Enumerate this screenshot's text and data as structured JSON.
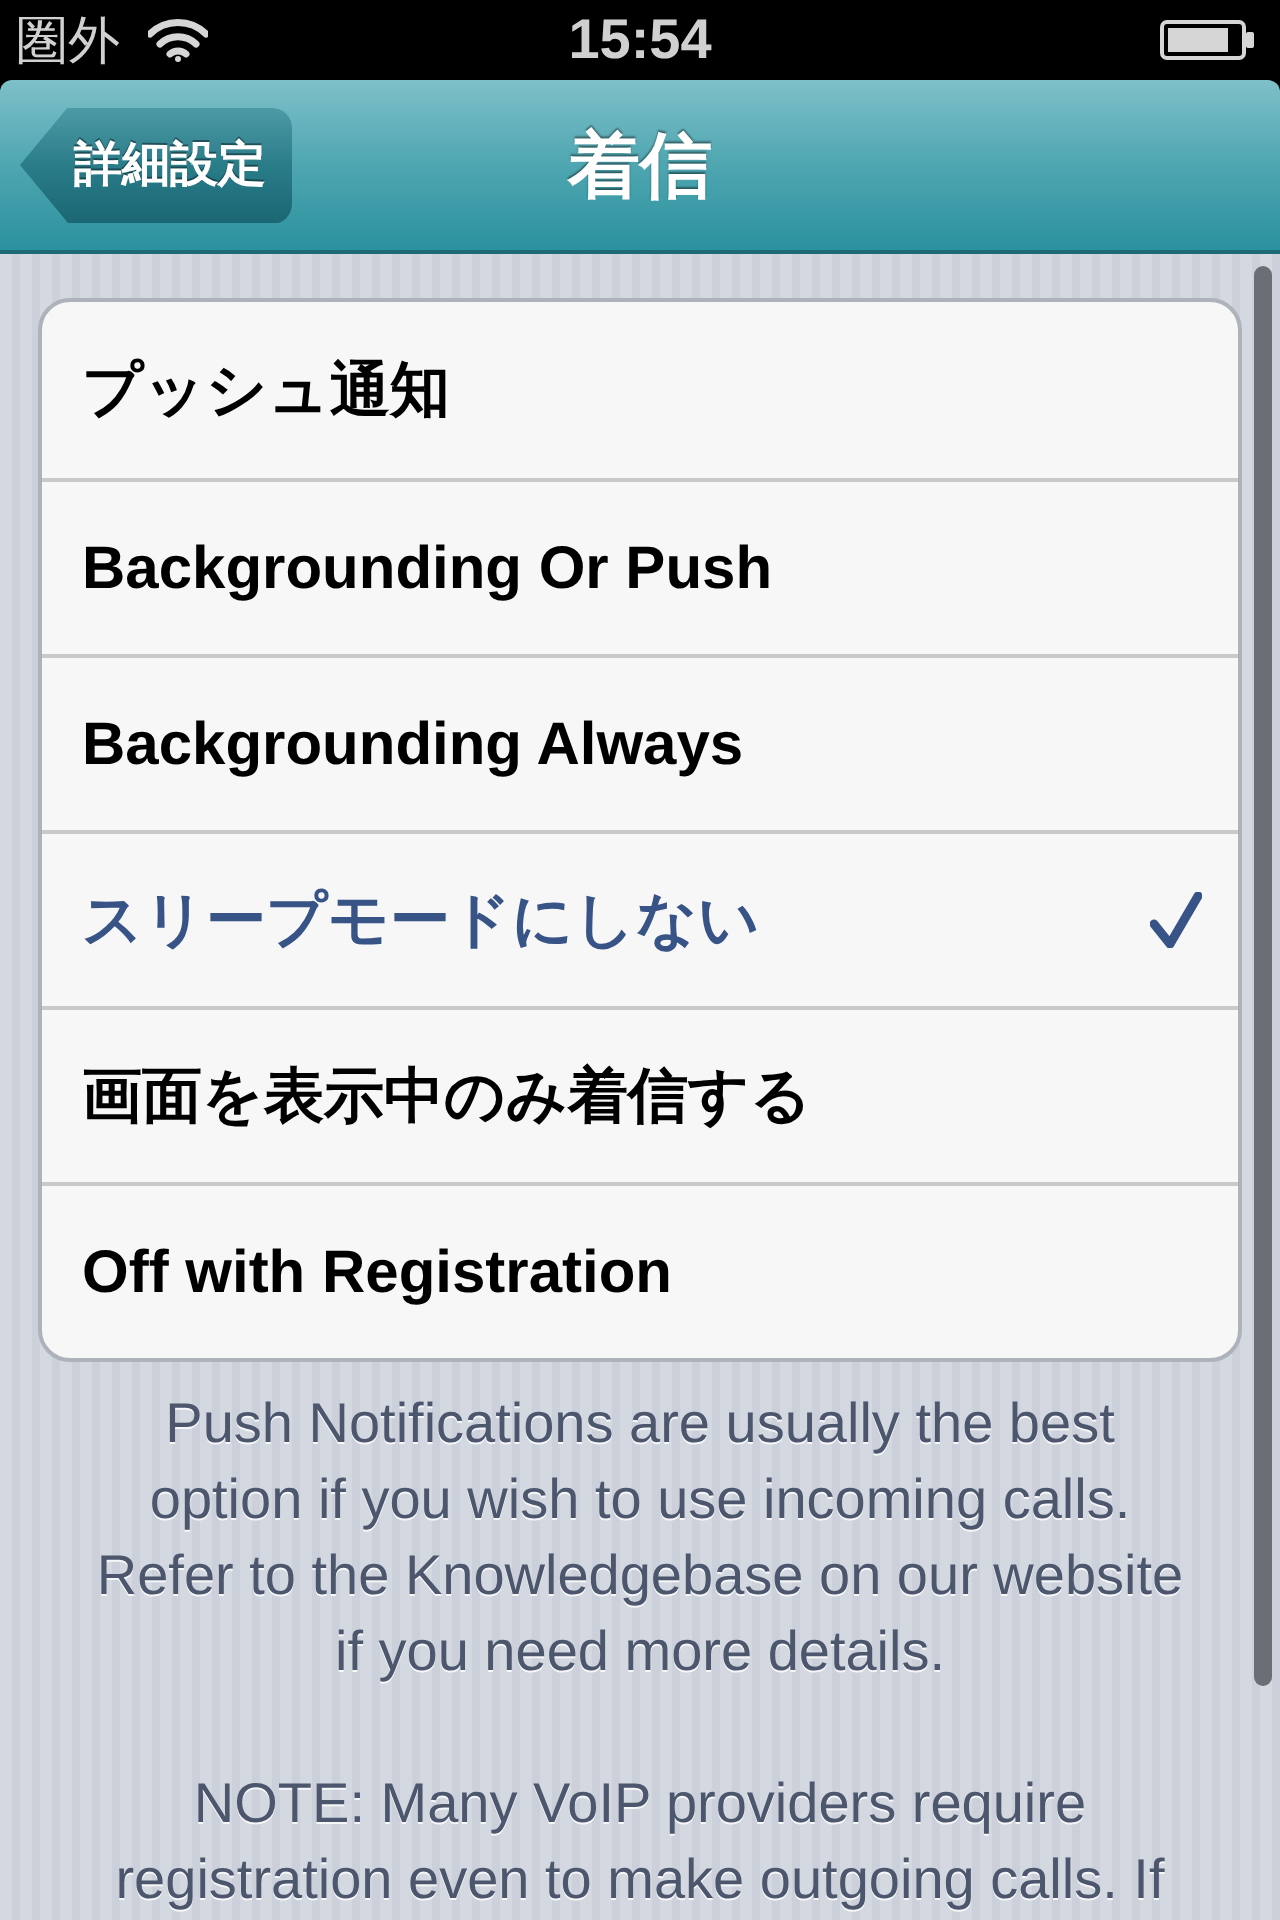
{
  "status_bar": {
    "carrier": "圏外",
    "time": "15:54"
  },
  "nav_bar": {
    "back_button": "詳細設定",
    "title": "着信"
  },
  "options": [
    {
      "label": "プッシュ通知",
      "selected": false
    },
    {
      "label": "Backgrounding Or Push",
      "selected": false
    },
    {
      "label": "Backgrounding Always",
      "selected": false
    },
    {
      "label": "スリープモードにしない",
      "selected": true
    },
    {
      "label": "画面を表示中のみ着信する",
      "selected": false
    },
    {
      "label": "Off with Registration",
      "selected": false
    }
  ],
  "footer": {
    "paragraphs": [
      {
        "lines": [
          "Push Notifications are usually the best",
          "option if you wish to use incoming calls.",
          "Refer to the Knowledgebase on our website",
          "if you need more details."
        ]
      },
      {
        "lines": [
          "NOTE: Many VoIP providers require",
          "registration even to make outgoing calls. If"
        ]
      }
    ]
  }
}
